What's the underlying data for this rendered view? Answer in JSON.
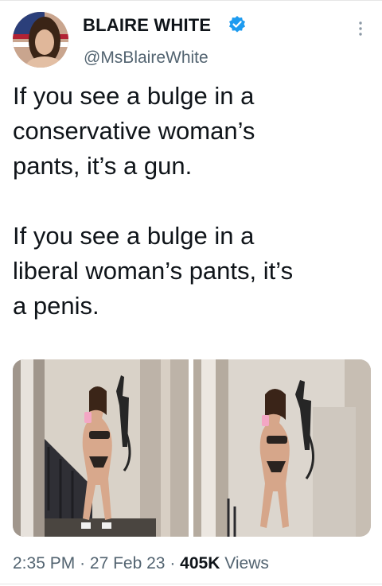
{
  "author": {
    "name": "BLAIRE WHITE",
    "handle": "@MsBlaireWhite",
    "verified": true
  },
  "tweet": {
    "text": "If you see a bulge in a\nconservative woman’s\npants, it’s a gun.\n\nIf you see a bulge in a\nliberal woman’s pants, it’s\na penis."
  },
  "media": [
    {
      "icon": "photo-mirror-selfie-left"
    },
    {
      "icon": "photo-mirror-selfie-right"
    }
  ],
  "meta": {
    "time": "2:35 PM",
    "separator": "·",
    "date": "27 Feb 23",
    "views_count": "405K",
    "views_label": "Views"
  },
  "colors": {
    "text": "#0f1419",
    "secondary": "#536471",
    "verified": "#1d9bf0"
  }
}
